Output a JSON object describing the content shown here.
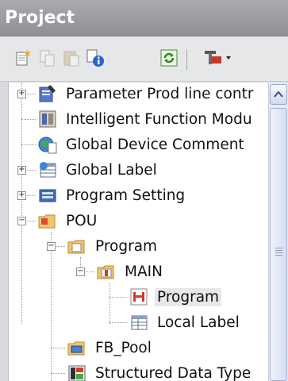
{
  "panel": {
    "title": "Project"
  },
  "toolbar": {
    "buttons": [
      "new-item",
      "copy",
      "paste",
      "properties",
      "refresh",
      "tools"
    ]
  },
  "tree": {
    "items": [
      {
        "label": "Parameter Prod line contr",
        "icon": "parameter-icon",
        "expandable": true,
        "expanded": false
      },
      {
        "label": "Intelligent Function Modu",
        "icon": "intelligent-module-icon",
        "expandable": false
      },
      {
        "label": "Global Device Comment",
        "icon": "device-comment-icon",
        "expandable": false
      },
      {
        "label": "Global Label",
        "icon": "global-label-icon",
        "expandable": true,
        "expanded": false
      },
      {
        "label": "Program Setting",
        "icon": "program-setting-icon",
        "expandable": true,
        "expanded": false
      },
      {
        "label": "POU",
        "icon": "pou-folder-icon",
        "expandable": true,
        "expanded": true
      },
      {
        "label": "Program",
        "icon": "program-folder-icon",
        "expandable": true,
        "expanded": true
      },
      {
        "label": "MAIN",
        "icon": "main-program-icon",
        "expandable": true,
        "expanded": true
      },
      {
        "label": "Program",
        "icon": "ladder-program-icon",
        "expandable": false,
        "selected": true
      },
      {
        "label": "Local Label",
        "icon": "local-label-icon",
        "expandable": false
      },
      {
        "label": "FB_Pool",
        "icon": "fb-pool-icon",
        "expandable": false
      },
      {
        "label": "Structured Data Type",
        "icon": "structured-data-icon",
        "expandable": false
      }
    ]
  },
  "colors": {
    "title_bar": "#9a9b9f",
    "selection": "#e8e8e8",
    "scrollbar": "#d7def0"
  }
}
